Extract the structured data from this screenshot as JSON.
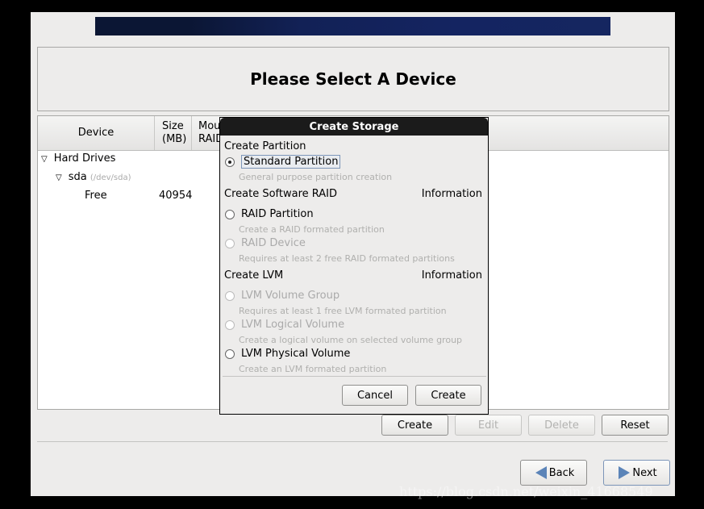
{
  "header": {
    "title": "Please Select A Device"
  },
  "table": {
    "columns": [
      "Device",
      "Size\n(MB)",
      "Mou\nRAID"
    ],
    "rows": [
      {
        "name": "Hard Drives"
      },
      {
        "name": "sda",
        "detail": "(/dev/sda)"
      },
      {
        "name": "Free",
        "size": "40954"
      }
    ]
  },
  "actions": {
    "create": "Create",
    "edit": "Edit",
    "delete": "Delete",
    "reset": "Reset"
  },
  "nav": {
    "back": "Back",
    "next": "Next"
  },
  "dialog": {
    "title": "Create Storage",
    "sections": [
      {
        "label": "Create Partition",
        "info": ""
      },
      {
        "label": "Create Software RAID",
        "info": "Information"
      },
      {
        "label": "Create LVM",
        "info": "Information"
      }
    ],
    "options": [
      {
        "label": "Standard Partition",
        "desc": "General purpose partition creation",
        "selected": true,
        "enabled": true
      },
      {
        "label": "RAID Partition",
        "desc": "Create a RAID formated partition",
        "selected": false,
        "enabled": true
      },
      {
        "label": "RAID Device",
        "desc": "Requires at least 2 free RAID formated partitions",
        "selected": false,
        "enabled": false
      },
      {
        "label": "LVM Volume Group",
        "desc": "Requires at least 1 free LVM formated partition",
        "selected": false,
        "enabled": false
      },
      {
        "label": "LVM Logical Volume",
        "desc": "Create a logical volume on selected volume group",
        "selected": false,
        "enabled": false
      },
      {
        "label": "LVM Physical Volume",
        "desc": "Create an LVM formated partition",
        "selected": false,
        "enabled": true
      }
    ],
    "cancel": "Cancel",
    "create": "Create"
  },
  "watermark": "https://blog.csdn.net/weixin_41668549",
  "colors": {
    "banner": "#142461",
    "arrow": "#5b84b8"
  }
}
